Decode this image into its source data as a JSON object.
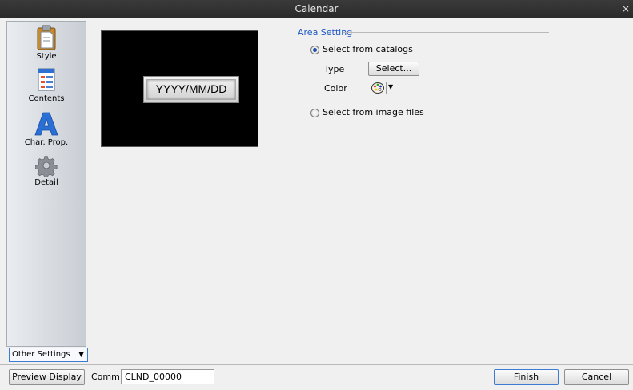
{
  "window": {
    "title": "Calendar",
    "close_glyph": "×"
  },
  "sidebar": {
    "items": [
      {
        "label": "Style",
        "icon": "clipboard-icon"
      },
      {
        "label": "Contents",
        "icon": "list-document-icon"
      },
      {
        "label": "Char. Prop.",
        "icon": "letter-a-icon"
      },
      {
        "label": "Detail",
        "icon": "gear-icon"
      }
    ],
    "other_settings_label": "Other Settings"
  },
  "preview": {
    "widget_text": "YYYY/MM/DD"
  },
  "area_setting": {
    "title": "Area Setting",
    "option_catalogs": "Select from catalogs",
    "option_image_files": "Select from image files",
    "selected": "catalogs",
    "type_label": "Type",
    "type_button": "Select...",
    "color_label": "Color"
  },
  "footer": {
    "preview_button": "Preview Display",
    "comm_label": "Comm",
    "comm_value": "CLND_00000",
    "finish_button": "Finish",
    "cancel_button": "Cancel"
  },
  "colors": {
    "accent": "#1c56c4",
    "titlebar": "#2b2b2b",
    "preview_bg": "#000000"
  }
}
